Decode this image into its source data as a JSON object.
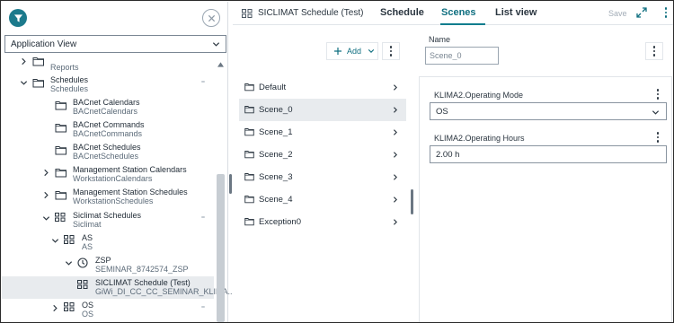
{
  "colors": {
    "accent": "#0f7d8e",
    "selected_bg": "#e8ebee",
    "disabled_text": "#a3adb7"
  },
  "left": {
    "view_select": "Application View",
    "tree": [
      {
        "title": "",
        "subtitle": "Reports",
        "icon": "folder-icon",
        "expander": "chevron-right",
        "indent": 0
      },
      {
        "title": "Schedules",
        "subtitle": "Schedules",
        "icon": "folder-icon",
        "expander": "chevron-down",
        "indent": 0
      },
      {
        "title": "BACnet Calendars",
        "subtitle": "BACnetCalendars",
        "icon": "folder-icon",
        "expander": "none",
        "indent": 1
      },
      {
        "title": "BACnet Commands",
        "subtitle": "BACnetCommands",
        "icon": "folder-icon",
        "expander": "none",
        "indent": 1
      },
      {
        "title": "BACnet Schedules",
        "subtitle": "BACnetSchedules",
        "icon": "folder-icon",
        "expander": "none",
        "indent": 1
      },
      {
        "title": "Management Station Calendars",
        "subtitle": "WorkstationCalendars",
        "icon": "folder-icon",
        "expander": "chevron-right",
        "indent": 1
      },
      {
        "title": "Management Station Schedules",
        "subtitle": "WorkstationSchedules",
        "icon": "folder-icon",
        "expander": "chevron-right",
        "indent": 1
      },
      {
        "title": "Siclimat Schedules",
        "subtitle": "Siclimat",
        "icon": "grid-icon",
        "expander": "chevron-down",
        "indent": 1
      },
      {
        "title": "AS",
        "subtitle": "AS",
        "icon": "grid-icon",
        "expander": "chevron-down",
        "indent": 2
      },
      {
        "title": "ZSP",
        "subtitle": "SEMINAR_8742574_ZSP",
        "icon": "clock-icon",
        "expander": "chevron-down",
        "indent": 3
      },
      {
        "title": "SICLIMAT Schedule (Test)",
        "subtitle": "GiWi_DI_CC_CC_SEMINAR_KLIMA...",
        "icon": "grid-icon",
        "expander": "none",
        "indent": 4
      },
      {
        "title": "OS",
        "subtitle": "OS",
        "icon": "grid-icon",
        "expander": "chevron-right",
        "indent": 2
      }
    ]
  },
  "topbar": {
    "title": "SICLIMAT Schedule (Test)",
    "tabs": [
      "Schedule",
      "Scenes",
      "List view"
    ],
    "active_tab": "Scenes",
    "save_label": "Save"
  },
  "middle": {
    "add_label": "Add",
    "items": [
      "Default",
      "Scene_0",
      "Scene_1",
      "Scene_2",
      "Scene_3",
      "Scene_4",
      "Exception0"
    ],
    "selected": "Scene_0"
  },
  "right": {
    "name_label": "Name",
    "name_value": "Scene_0",
    "props": [
      {
        "label": "KLIMA2.Operating Mode",
        "value": "OS",
        "kind": "select"
      },
      {
        "label": "KLIMA2.Operating Hours",
        "value": "2.00 h",
        "kind": "input"
      }
    ]
  }
}
